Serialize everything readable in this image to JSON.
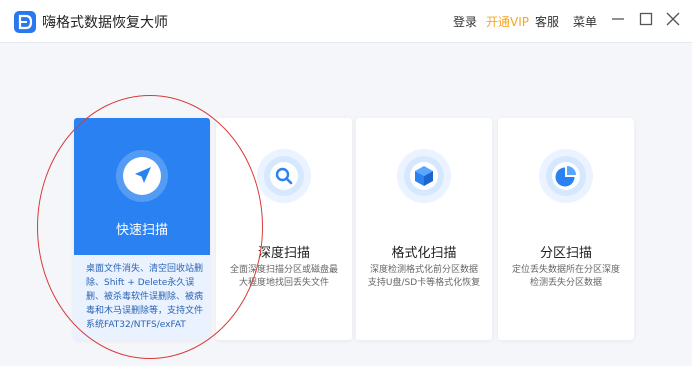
{
  "app": {
    "title": "嗨格式数据恢复大师"
  },
  "topnav": {
    "login": "登录",
    "vip": "开通VIP",
    "service": "客服",
    "menu": "菜单"
  },
  "colors": {
    "accent": "#2a82f2",
    "vip": "#f5a623",
    "annotation": "#d93b3b"
  },
  "icons": {
    "logo": "app-logo-icon",
    "minimize": "minimize-icon",
    "maximize": "maximize-icon",
    "close": "close-icon",
    "quick": "navigation-arrow-icon",
    "deep": "magnifier-icon",
    "format": "cube-icon",
    "partition": "pie-chart-icon"
  },
  "cards": [
    {
      "title": "快速扫描",
      "desc": "桌面文件消失、清空回收站删除、Shift + Delete永久误删、被杀毒软件误删除、被病毒和木马误删除等，支持文件系统FAT32/NTFS/exFAT"
    },
    {
      "title": "深度扫描",
      "desc": "全面深度扫描分区或磁盘最大程度地找回丢失文件"
    },
    {
      "title": "格式化扫描",
      "desc": "深度检测格式化前分区数据支持U盘/SD卡等格式化恢复"
    },
    {
      "title": "分区扫描",
      "desc": "定位丢失数据所在分区深度检测丢失分区数据"
    }
  ]
}
